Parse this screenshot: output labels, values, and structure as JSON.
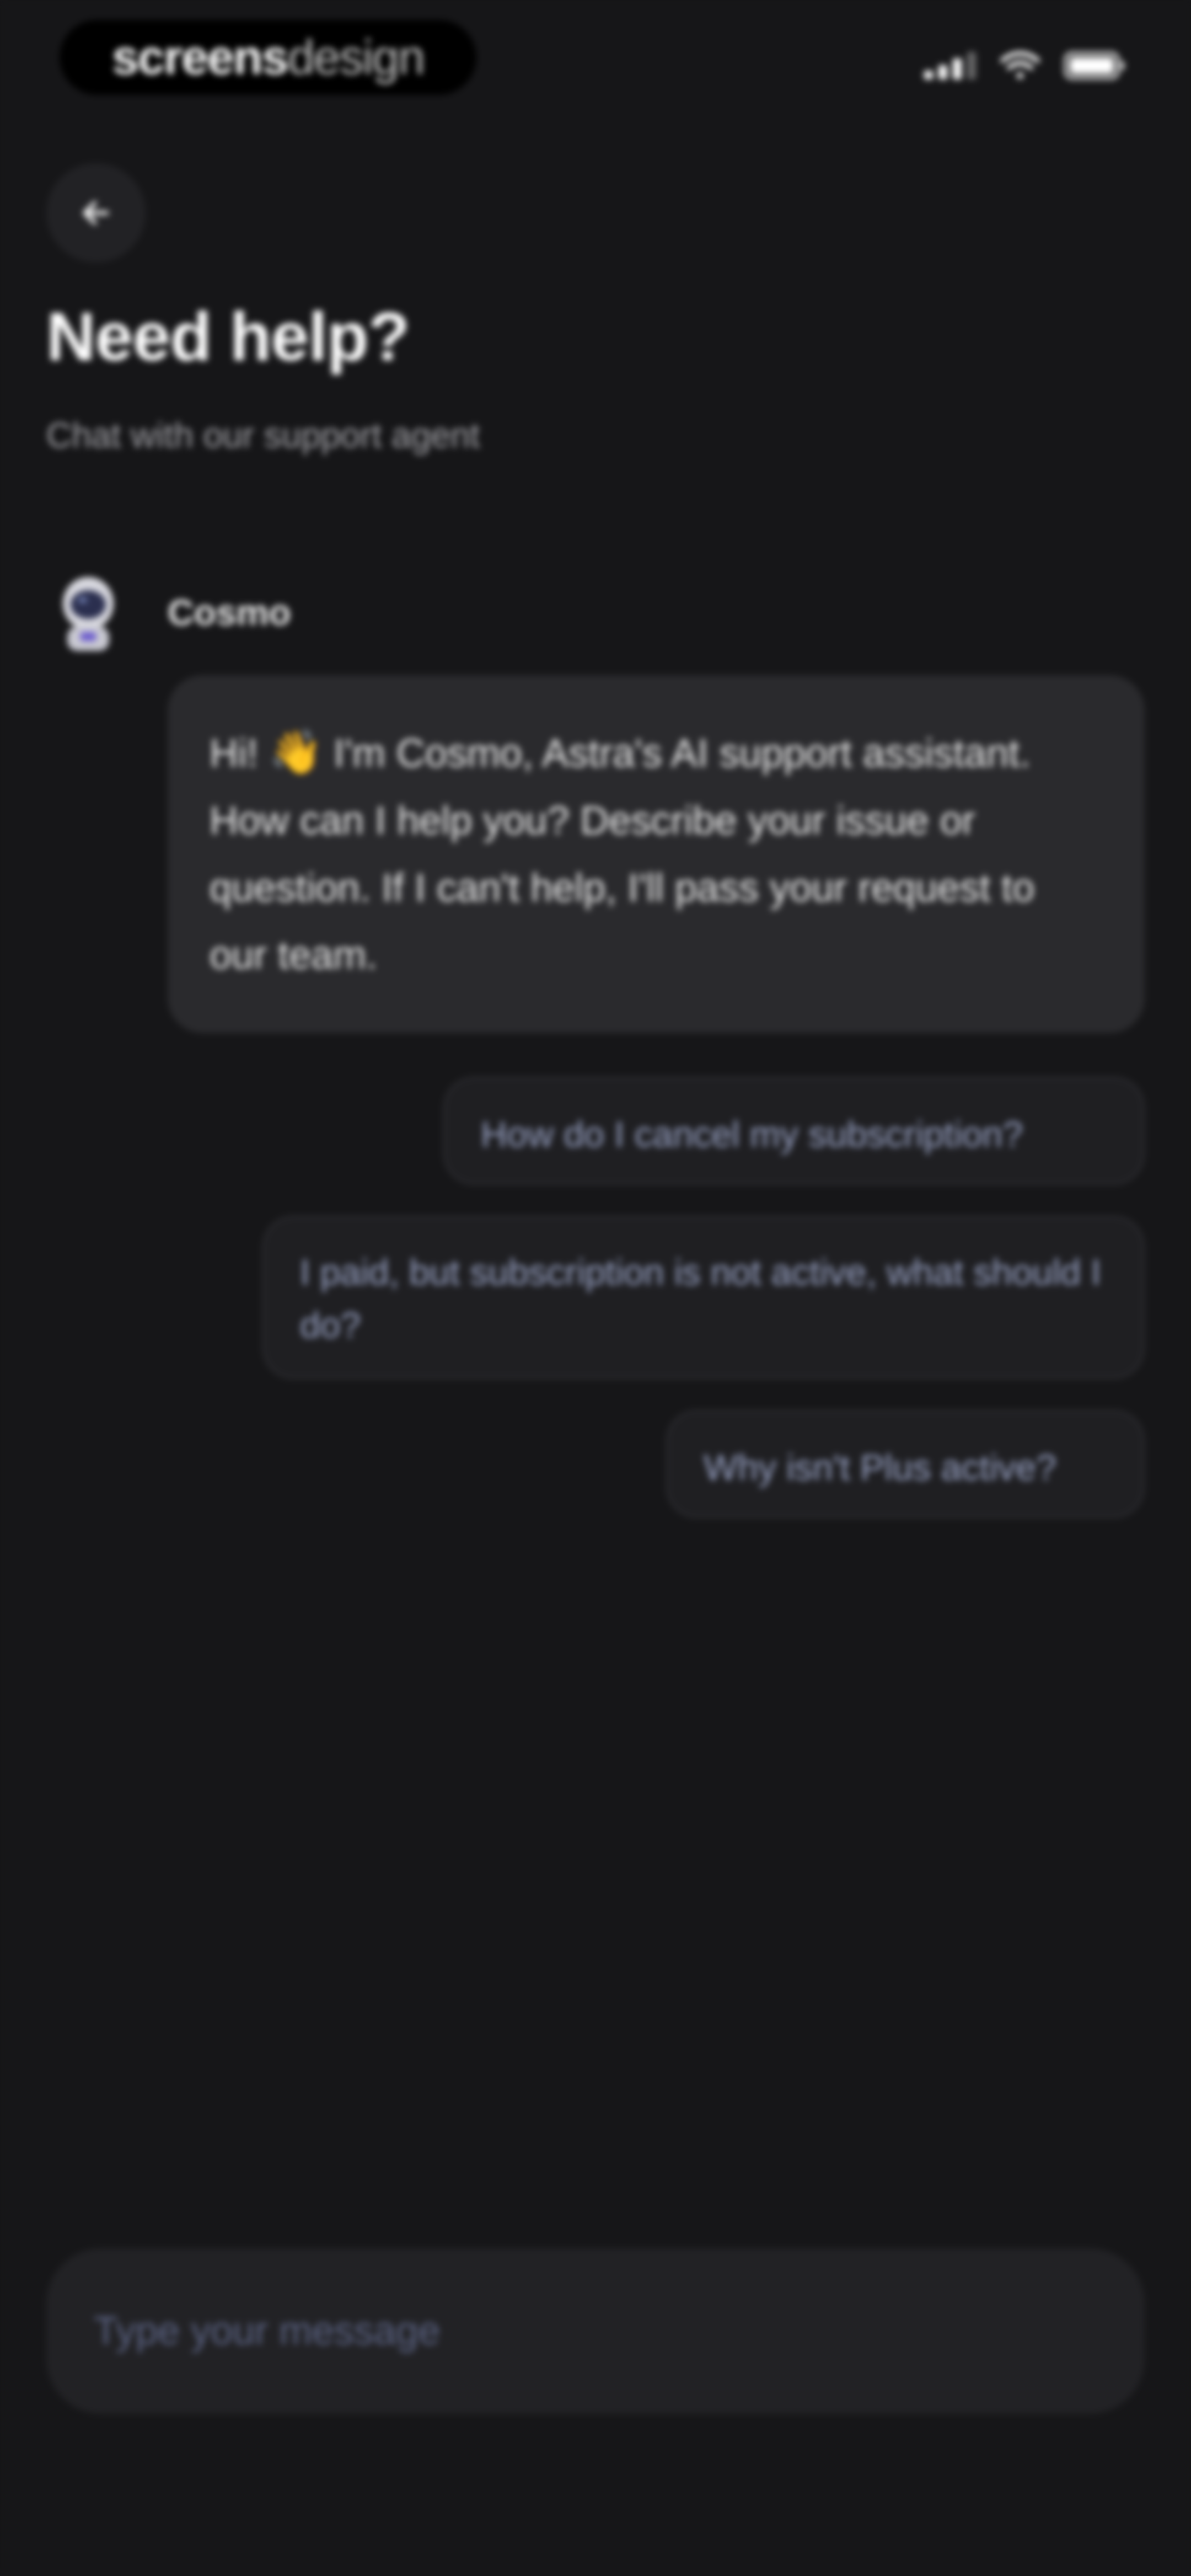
{
  "status_bar": {
    "brand_strong": "screens",
    "brand_light": "design"
  },
  "header": {
    "title": "Need help?",
    "subtitle": "Chat with our support agent"
  },
  "agent": {
    "name": "Cosmo",
    "greeting_before_emoji": "Hi! ",
    "greeting_emoji": "👋",
    "greeting_after_emoji": " I'm Cosmo, Astra's AI support assistant. How can I help you? Describe your issue or question. If I can't help, I'll pass your request to our team."
  },
  "suggestions": [
    "How do I cancel my subscription?",
    "I paid, but subscription is not active, what should I do?",
    "Why isn't Plus active?"
  ],
  "composer": {
    "placeholder": "Type your message"
  },
  "icons": {
    "back": "arrow-left-icon",
    "signal": "cellular-signal-icon",
    "wifi": "wifi-icon",
    "battery": "battery-icon",
    "avatar": "astronaut-avatar-icon"
  },
  "colors": {
    "background": "#161618",
    "bubble": "#2a2a2d",
    "suggestion_text": "#9aa4c6",
    "placeholder": "#5b6383"
  }
}
